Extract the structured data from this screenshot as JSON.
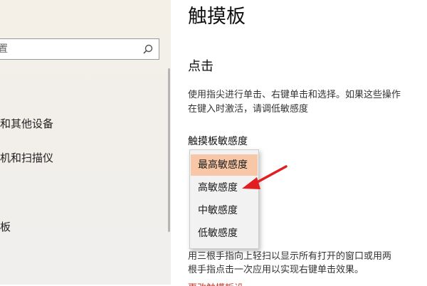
{
  "sidebar": {
    "search_text": "置",
    "items": [
      {
        "label": "和其他设备"
      },
      {
        "label": "机和扫描仪"
      },
      {
        "label": "板"
      }
    ]
  },
  "main": {
    "page_title": "触摸板",
    "section_title": "点击",
    "desc_line1": "使用指尖进行单击、右键单击和选择。如果这些操作",
    "desc_line2": "在键入时激活，请调低敏感度",
    "sensitivity_label": "触摸板敏感度",
    "bottom_line1": "用三根手指向上轻扫以显示所有打开的窗口或用两",
    "bottom_line2": "根手指点击一次应用以实现右键单击效果。",
    "bottom_link": "更改触摸板设置"
  },
  "dropdown": {
    "selected": "最高敏感度",
    "options": [
      "最高敏感度",
      "高敏感度",
      "中敏感度",
      "低敏感度"
    ]
  },
  "colors": {
    "selected_highlight": "#f7c7a7",
    "arrow": "#e02020",
    "link": "#c0392b"
  },
  "icons": [
    "search-icon",
    "red-arrow-annotation"
  ]
}
